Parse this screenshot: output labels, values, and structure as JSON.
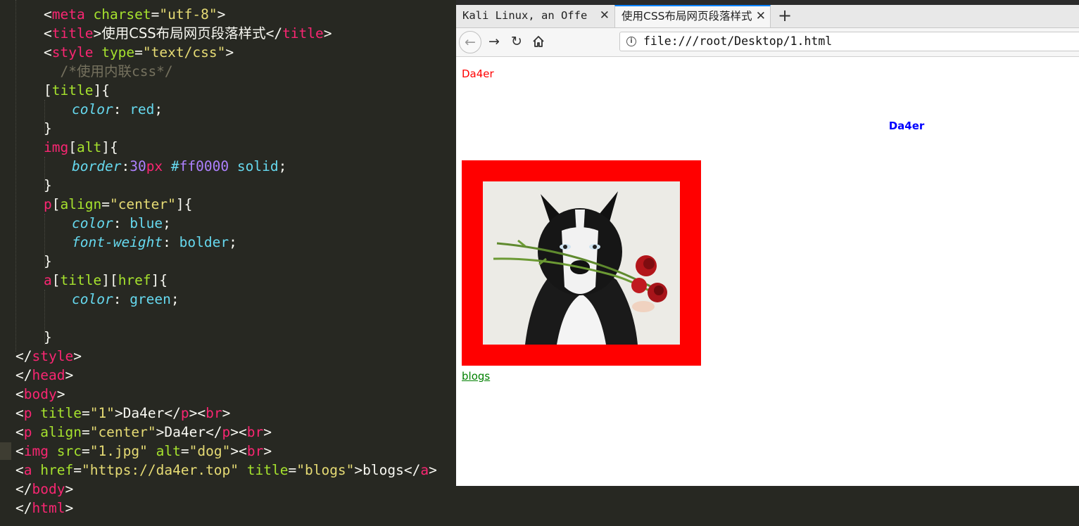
{
  "editor": {
    "lines": [
      {
        "indent": 1,
        "tokens": [
          [
            "p",
            "<"
          ],
          [
            "k",
            "meta"
          ],
          [
            "p",
            " "
          ],
          [
            "a",
            "charset"
          ],
          [
            "p",
            "="
          ],
          [
            "s",
            "\"utf-8\""
          ],
          [
            "p",
            ">"
          ]
        ]
      },
      {
        "indent": 1,
        "tokens": [
          [
            "p",
            "<"
          ],
          [
            "k",
            "title"
          ],
          [
            "p",
            ">"
          ],
          [
            "cjk",
            "使用CSS布局网页段落样式"
          ],
          [
            "p",
            "</"
          ],
          [
            "k",
            "title"
          ],
          [
            "p",
            ">"
          ]
        ]
      },
      {
        "indent": 1,
        "tokens": [
          [
            "p",
            "<"
          ],
          [
            "k",
            "style"
          ],
          [
            "p",
            " "
          ],
          [
            "a",
            "type"
          ],
          [
            "p",
            "="
          ],
          [
            "s",
            "\"text/css\""
          ],
          [
            "p",
            ">"
          ]
        ]
      },
      {
        "indent": 1,
        "tokens": [
          [
            "cm",
            "  /*使用内联css*/"
          ]
        ]
      },
      {
        "indent": 1,
        "tokens": [
          [
            "p",
            "["
          ],
          [
            "a",
            "title"
          ],
          [
            "p",
            "]{"
          ]
        ]
      },
      {
        "indent": 2,
        "tokens": [
          [
            "pr",
            "color"
          ],
          [
            "p",
            ": "
          ],
          [
            "v",
            "red"
          ],
          [
            "p",
            ";"
          ]
        ]
      },
      {
        "indent": 1,
        "tokens": [
          [
            "p",
            "}"
          ]
        ]
      },
      {
        "indent": 1,
        "tokens": [
          [
            "k",
            "img"
          ],
          [
            "p",
            "["
          ],
          [
            "a",
            "alt"
          ],
          [
            "p",
            "]{"
          ]
        ]
      },
      {
        "indent": 2,
        "tokens": [
          [
            "pr",
            "border"
          ],
          [
            "p",
            ":"
          ],
          [
            "n",
            "30"
          ],
          [
            "k",
            "px"
          ],
          [
            "p",
            " "
          ],
          [
            "v",
            "#"
          ],
          [
            "n",
            "ff0000"
          ],
          [
            "p",
            " "
          ],
          [
            "v",
            "solid"
          ],
          [
            "p",
            ";"
          ]
        ]
      },
      {
        "indent": 1,
        "tokens": [
          [
            "p",
            "}"
          ]
        ]
      },
      {
        "indent": 1,
        "tokens": [
          [
            "k",
            "p"
          ],
          [
            "p",
            "["
          ],
          [
            "a",
            "align"
          ],
          [
            "p",
            "="
          ],
          [
            "s",
            "\"center\""
          ],
          [
            "p",
            "]{"
          ]
        ]
      },
      {
        "indent": 2,
        "tokens": [
          [
            "pr",
            "color"
          ],
          [
            "p",
            ": "
          ],
          [
            "v",
            "blue"
          ],
          [
            "p",
            ";"
          ]
        ]
      },
      {
        "indent": 2,
        "tokens": [
          [
            "pr",
            "font-weight"
          ],
          [
            "p",
            ": "
          ],
          [
            "v",
            "bolder"
          ],
          [
            "p",
            ";"
          ]
        ]
      },
      {
        "indent": 1,
        "tokens": [
          [
            "p",
            "}"
          ]
        ]
      },
      {
        "indent": 1,
        "tokens": [
          [
            "k",
            "a"
          ],
          [
            "p",
            "["
          ],
          [
            "a",
            "title"
          ],
          [
            "p",
            "]["
          ],
          [
            "a",
            "href"
          ],
          [
            "p",
            "]{"
          ]
        ]
      },
      {
        "indent": 2,
        "tokens": [
          [
            "pr",
            "color"
          ],
          [
            "p",
            ": "
          ],
          [
            "v",
            "green"
          ],
          [
            "p",
            ";"
          ]
        ]
      },
      {
        "indent": 0,
        "tokens": []
      },
      {
        "indent": 1,
        "tokens": [
          [
            "p",
            "}"
          ]
        ]
      },
      {
        "indent": 0,
        "tokens": [
          [
            "p",
            "</"
          ],
          [
            "k",
            "style"
          ],
          [
            "p",
            ">"
          ]
        ]
      },
      {
        "indent": 0,
        "tokens": [
          [
            "p",
            "</"
          ],
          [
            "k",
            "head"
          ],
          [
            "p",
            ">"
          ]
        ]
      },
      {
        "indent": 0,
        "tokens": [
          [
            "p",
            "<"
          ],
          [
            "k",
            "body"
          ],
          [
            "p",
            ">"
          ]
        ]
      },
      {
        "indent": 0,
        "tokens": [
          [
            "p",
            "<"
          ],
          [
            "k",
            "p"
          ],
          [
            "p",
            " "
          ],
          [
            "a",
            "title"
          ],
          [
            "p",
            "="
          ],
          [
            "s",
            "\"1\""
          ],
          [
            "p",
            ">Da4er</"
          ],
          [
            "k",
            "p"
          ],
          [
            "p",
            "><"
          ],
          [
            "k",
            "br"
          ],
          [
            "p",
            ">"
          ]
        ]
      },
      {
        "indent": 0,
        "tokens": [
          [
            "p",
            "<"
          ],
          [
            "k",
            "p"
          ],
          [
            "p",
            " "
          ],
          [
            "a",
            "align"
          ],
          [
            "p",
            "="
          ],
          [
            "s",
            "\"center\""
          ],
          [
            "p",
            ">Da4er</"
          ],
          [
            "k",
            "p"
          ],
          [
            "p",
            "><"
          ],
          [
            "k",
            "br"
          ],
          [
            "p",
            ">"
          ]
        ]
      },
      {
        "indent": 0,
        "tokens": [
          [
            "p",
            "<"
          ],
          [
            "k",
            "img"
          ],
          [
            "p",
            " "
          ],
          [
            "a",
            "src"
          ],
          [
            "p",
            "="
          ],
          [
            "s",
            "\"1.jpg\""
          ],
          [
            "p",
            " "
          ],
          [
            "a",
            "alt"
          ],
          [
            "p",
            "="
          ],
          [
            "s",
            "\"dog\""
          ],
          [
            "p",
            "><"
          ],
          [
            "k",
            "br"
          ],
          [
            "p",
            ">"
          ]
        ]
      },
      {
        "indent": 0,
        "tokens": [
          [
            "p",
            "<"
          ],
          [
            "k",
            "a"
          ],
          [
            "p",
            " "
          ],
          [
            "a",
            "href"
          ],
          [
            "p",
            "="
          ],
          [
            "s",
            "\"https://da4er.top\""
          ],
          [
            "p",
            " "
          ],
          [
            "a",
            "title"
          ],
          [
            "p",
            "="
          ],
          [
            "s",
            "\"blogs\""
          ],
          [
            "p",
            ">blogs</"
          ],
          [
            "k",
            "a"
          ],
          [
            "p",
            ">"
          ]
        ]
      },
      {
        "indent": 0,
        "tokens": [
          [
            "p",
            "</"
          ],
          [
            "k",
            "body"
          ],
          [
            "p",
            ">"
          ]
        ]
      },
      {
        "indent": 0,
        "tokens": [
          [
            "p",
            "</"
          ],
          [
            "k",
            "html"
          ],
          [
            "p",
            ">"
          ]
        ]
      }
    ]
  },
  "browser": {
    "tabs": [
      {
        "label": "Kali Linux, an Offe",
        "active": false
      },
      {
        "label": "使用CSS布局网页段落样式",
        "active": true
      }
    ],
    "new_tab_label": "+",
    "url": "file:///root/Desktop/1.html",
    "icons": {
      "back": "back-arrow-icon",
      "forward": "forward-arrow-icon",
      "reload": "reload-icon",
      "home": "home-icon",
      "info": "info-icon",
      "close": "close-icon"
    }
  },
  "page": {
    "title_paragraph": "Da4er",
    "center_paragraph": "Da4er",
    "image_alt": "dog",
    "link_text": "blogs",
    "colors": {
      "title_paragraph": "#ff0000",
      "center_paragraph": "#0000ff",
      "image_border": "#ff0000",
      "link": "#008000"
    }
  }
}
